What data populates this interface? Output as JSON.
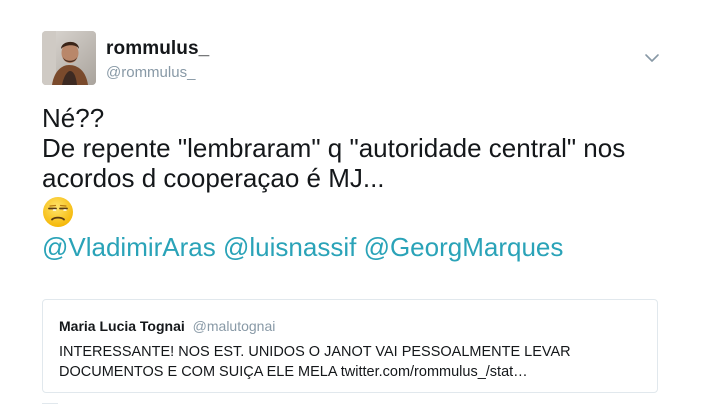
{
  "author": {
    "display_name": "rommulus_",
    "handle": "@rommulus_"
  },
  "menu": {
    "icon": "chevron-down-icon"
  },
  "tweet": {
    "lines": [
      "Né??",
      "De repente \"lembraram\" q \"autoridade central\" nos",
      "acordos d cooperaçao é MJ..."
    ],
    "emoji": "unamused-face-emoji",
    "mentions": [
      "@VladimirAras",
      "@luisnassif",
      "@GeorgMarques"
    ]
  },
  "quoted_tweet": {
    "display_name": "Maria Lucia Tognai",
    "handle": "@malutognai",
    "lines": [
      "INTERESSANTE! NOS EST. UNIDOS O JANOT VAI PESSOALMENTE LEVAR",
      "DOCUMENTOS E COM SUIÇA ELE MELA twitter.com/rommulus_/stat…"
    ]
  },
  "colors": {
    "text": "#14171a",
    "secondary": "#8899a6",
    "mention": "#2aa3b8",
    "border": "#e1e8ed"
  }
}
